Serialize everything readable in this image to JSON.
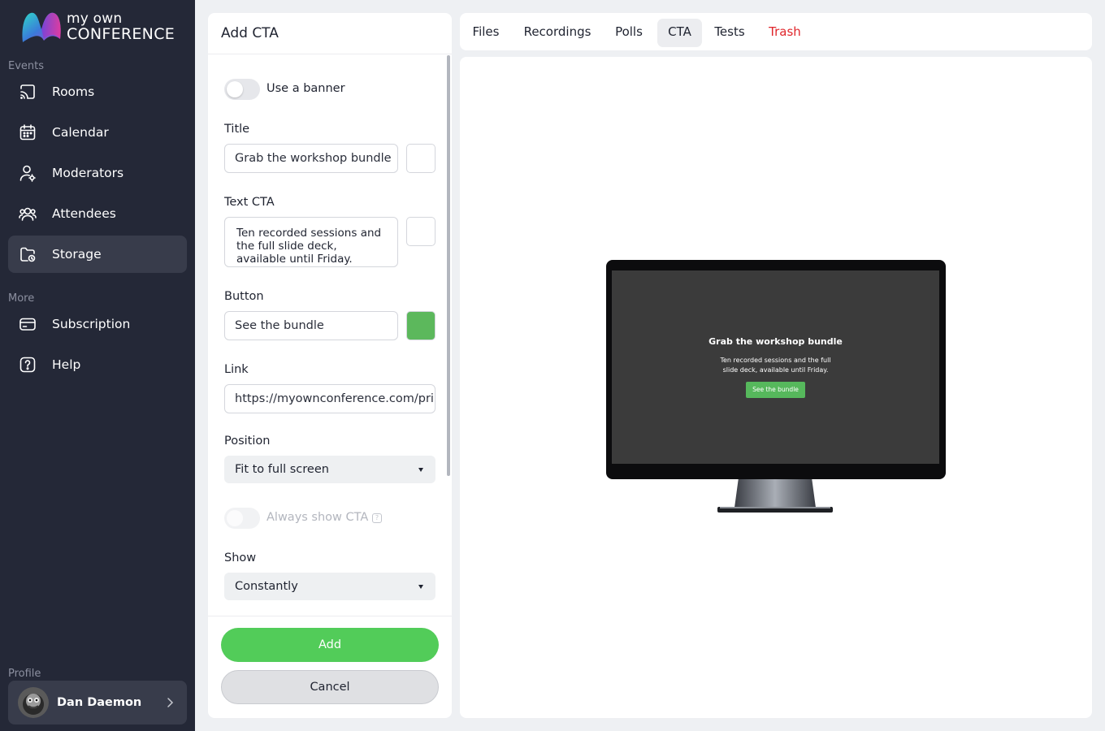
{
  "brand": {
    "line1": "my own",
    "line2": "CONFERENCE"
  },
  "sidebar": {
    "events_label": "Events",
    "more_label": "More",
    "profile_label": "Profile",
    "items": [
      {
        "label": "Rooms",
        "icon": "cast-icon"
      },
      {
        "label": "Calendar",
        "icon": "calendar-icon"
      },
      {
        "label": "Moderators",
        "icon": "moderator-icon"
      },
      {
        "label": "Attendees",
        "icon": "attendees-icon"
      },
      {
        "label": "Storage",
        "icon": "folder-icon",
        "active": true
      }
    ],
    "more_items": [
      {
        "label": "Subscription",
        "icon": "card-icon"
      },
      {
        "label": "Help",
        "icon": "help-icon"
      }
    ],
    "profile_name": "Dan Daemon"
  },
  "form": {
    "title": "Add CTA",
    "banner_toggle_label": "Use a banner",
    "title_label": "Title",
    "title_value": "Grab the workshop bundle",
    "text_label": "Text CTA",
    "text_value": "Ten recorded sessions and the full slide deck, available until Friday.",
    "button_label": "Button",
    "button_value": "See the bundle",
    "button_color": "#5cb85c",
    "link_label": "Link",
    "link_value": "https://myownconference.com/pri",
    "position_label": "Position",
    "position_value": "Fit to full screen",
    "always_show_label": "Always show CTA",
    "show_label": "Show",
    "show_value": "Constantly",
    "add_button": "Add",
    "cancel_button": "Cancel"
  },
  "tabs": [
    {
      "label": "Files"
    },
    {
      "label": "Recordings"
    },
    {
      "label": "Polls"
    },
    {
      "label": "CTA",
      "active": true
    },
    {
      "label": "Tests"
    },
    {
      "label": "Trash",
      "color": "#e0262b"
    }
  ],
  "preview": {
    "title": "Grab the workshop bundle",
    "text": "Ten recorded sessions and the full slide deck, available until Friday.",
    "button": "See the bundle"
  }
}
